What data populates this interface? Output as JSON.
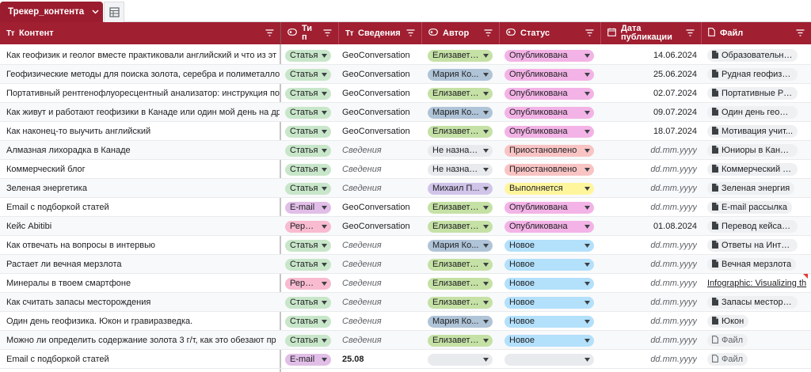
{
  "sheet": {
    "tab_label": "Трекер_контента",
    "chevron_icon": "chevron-down-icon",
    "side_icon": "table-view-icon"
  },
  "columns": [
    {
      "key": "content",
      "type_glyph": "Тт",
      "label": "Контент"
    },
    {
      "key": "type",
      "type_glyph": "chip-icon",
      "label": "Ти п"
    },
    {
      "key": "info",
      "type_glyph": "Тт",
      "label": "Сведения"
    },
    {
      "key": "author",
      "type_glyph": "chip-icon",
      "label": "Автор"
    },
    {
      "key": "status",
      "type_glyph": "chip-icon",
      "label": "Статус"
    },
    {
      "key": "date",
      "type_glyph": "calendar-icon",
      "label": "Дата публикации"
    },
    {
      "key": "file",
      "type_glyph": "document-icon",
      "label": "Файл"
    }
  ],
  "colors": {
    "header_bg": "#a01f31",
    "type_Статья": "#c8e6c9",
    "type_E-mail": "#e1bee7",
    "type_Рерайт": "#f8bbd0",
    "author_Елизавета": "#c5e1a5",
    "author_Мария": "#b0c4d8",
    "author_Михаил": "#d1c4e9",
    "author_none": "#e8eaed",
    "status_Опубликована": "#f3b3e6",
    "status_Приостановлено": "#f9c4c4",
    "status_Выполняется": "#fff59d",
    "status_Новое": "#b3e0fb",
    "status_none": "#e8eaed"
  },
  "rows": [
    {
      "content": "Как геофизик и геолог вместе практиковали английский и что из эт",
      "type": "Статья",
      "info": "GeoConversation",
      "info_style": "normal",
      "author": "Елизавета...",
      "author_key": "author_Елизавета",
      "status": "Опубликована",
      "status_key": "status_Опубликована",
      "date": "14.06.2024",
      "date_style": "normal",
      "file": "Образовательны...",
      "file_style": "chip",
      "file_icon": "document-icon"
    },
    {
      "content": "Геофизические методы для поиска золота, серебра и полиметаллов",
      "type": "Статья",
      "info": "GeoConversation",
      "info_style": "normal",
      "author": "Мария Ко...",
      "author_key": "author_Мария",
      "status": "Опубликована",
      "status_key": "status_Опубликована",
      "date": "25.06.2024",
      "date_style": "normal",
      "file": "Рудная геофизика",
      "file_style": "chip",
      "file_icon": "document-icon"
    },
    {
      "content": "Портативный рентгенофлуоресцентный анализатор: инструкция по",
      "type": "Статья",
      "info": "GeoConversation",
      "info_style": "normal",
      "author": "Елизавета...",
      "author_key": "author_Елизавета",
      "status": "Опубликована",
      "status_key": "status_Опубликована",
      "date": "02.07.2024",
      "date_style": "normal",
      "file": "Портативные РФА",
      "file_style": "chip",
      "file_icon": "document-icon"
    },
    {
      "content": "Как живут и работают геофизики в Канаде или один мой день на др",
      "type": "Статья",
      "info": "GeoConversation",
      "info_style": "normal",
      "author": "Мария Ко...",
      "author_key": "author_Мария",
      "status": "Опубликована",
      "status_key": "status_Опубликована",
      "date": "09.07.2024",
      "date_style": "normal",
      "file": "Один день геофи...",
      "file_style": "chip",
      "file_icon": "document-icon"
    },
    {
      "content": "Как наконец-то выучить английский",
      "type": "Статья",
      "info": "GeoConversation",
      "info_style": "normal",
      "author": "Елизавета...",
      "author_key": "author_Елизавета",
      "status": "Опубликована",
      "status_key": "status_Опубликована",
      "date": "18.07.2024",
      "date_style": "normal",
      "file": "Мотивация учит...",
      "file_style": "chip",
      "file_icon": "document-icon"
    },
    {
      "content": "Алмазная лихорадка в Канаде",
      "type": "Статья",
      "info": "Сведения",
      "info_style": "italic",
      "author": "Не назнач...",
      "author_key": "author_none",
      "status": "Приостановлено",
      "status_key": "status_Приостановлено",
      "date": "dd.mm.yyyy",
      "date_style": "italic",
      "file": "Юниоры в Канаде",
      "file_style": "chip",
      "file_icon": "document-icon"
    },
    {
      "content": "Коммерческий блог",
      "type": "Статья",
      "info": "Сведения",
      "info_style": "italic",
      "author": "Не назнач...",
      "author_key": "author_none",
      "status": "Приостановлено",
      "status_key": "status_Приостановлено",
      "date": "dd.mm.yyyy",
      "date_style": "italic",
      "file": "Коммерческий б...",
      "file_style": "chip",
      "file_icon": "document-icon"
    },
    {
      "content": "Зеленая энергетика",
      "type": "Статья",
      "info": "Сведения",
      "info_style": "italic",
      "author": "Михаил П...",
      "author_key": "author_Михаил",
      "status": "Выполняется",
      "status_key": "status_Выполняется",
      "date": "dd.mm.yyyy",
      "date_style": "italic",
      "file": "Зеленая энергия",
      "file_style": "chip",
      "file_icon": "document-icon"
    },
    {
      "content": "Email  с подборкой статей",
      "type": "E-mail",
      "info": "GeoConversation",
      "info_style": "normal",
      "author": "Елизавета...",
      "author_key": "author_Елизавета",
      "status": "Опубликована",
      "status_key": "status_Опубликована",
      "date": "dd.mm.yyyy",
      "date_style": "italic",
      "file": "E-mail рассылка",
      "file_style": "chip",
      "file_icon": "document-icon"
    },
    {
      "content": "Кейс Abitibi",
      "type": "Рерайт",
      "info": "GeoConversation",
      "info_style": "normal",
      "author": "Елизавета...",
      "author_key": "author_Елизавета",
      "status": "Опубликована",
      "status_key": "status_Опубликована",
      "date": "01.08.2024",
      "date_style": "normal",
      "file": "Перевод кейса д...",
      "file_style": "chip",
      "file_icon": "document-icon"
    },
    {
      "content": "Как отвечать на вопросы в интервью",
      "type": "Статья",
      "info": "Сведения",
      "info_style": "italic",
      "author": "Мария Ко...",
      "author_key": "author_Мария",
      "status": "Новое",
      "status_key": "status_Новое",
      "date": "dd.mm.yyyy",
      "date_style": "italic",
      "file": "Ответы на Интер...",
      "file_style": "chip",
      "file_icon": "document-icon"
    },
    {
      "content": "Растает ли вечная мерзлота",
      "type": "Статья",
      "info": "Сведения",
      "info_style": "italic",
      "author": "Елизавета...",
      "author_key": "author_Елизавета",
      "status": "Новое",
      "status_key": "status_Новое",
      "date": "dd.mm.yyyy",
      "date_style": "italic",
      "file": "Вечная мерзлота",
      "file_style": "chip",
      "file_icon": "document-icon"
    },
    {
      "content": "Минералы в твоем смартфоне",
      "type": "Рерайт",
      "info": "Сведения",
      "info_style": "italic",
      "author": "Елизавета...",
      "author_key": "author_Елизавета",
      "status": "Новое",
      "status_key": "status_Новое",
      "date": "dd.mm.yyyy",
      "date_style": "italic",
      "file": "Infographic: Visualizing th",
      "file_style": "link",
      "file_icon": ""
    },
    {
      "content": "Как считать запасы месторождения",
      "type": "Статья",
      "info": "Сведения",
      "info_style": "italic",
      "author": "Елизавета...",
      "author_key": "author_Елизавета",
      "status": "Новое",
      "status_key": "status_Новое",
      "date": "dd.mm.yyyy",
      "date_style": "italic",
      "file": "Запасы месторо...",
      "file_style": "chip",
      "file_icon": "document-icon"
    },
    {
      "content": "Один день геофизика. Юкон и гравиразведка.",
      "type": "Статья",
      "info": "Сведения",
      "info_style": "italic",
      "author": "Мария Ко...",
      "author_key": "author_Мария",
      "status": "Новое",
      "status_key": "status_Новое",
      "date": "dd.mm.yyyy",
      "date_style": "italic",
      "file": "Юкон",
      "file_style": "chip",
      "file_icon": "document-icon"
    },
    {
      "content": "Можно ли определить содержание золота 3 г/т, как это обезают пр",
      "type": "Статья",
      "info": "Сведения",
      "info_style": "italic",
      "author": "Елизавета...",
      "author_key": "author_Елизавета",
      "status": "Новое",
      "status_key": "status_Новое",
      "date": "dd.mm.yyyy",
      "date_style": "italic",
      "file": "Файл",
      "file_style": "chip",
      "file_icon": "file-outline-icon"
    },
    {
      "content": "Email  с подборкой статей",
      "type": "E-mail",
      "info": "25.08",
      "info_style": "bold",
      "author": "",
      "author_key": "author_none",
      "status": "",
      "status_key": "status_none",
      "date": "dd.mm.yyyy",
      "date_style": "italic",
      "file": "Файл",
      "file_style": "chip",
      "file_icon": "file-outline-icon"
    }
  ]
}
